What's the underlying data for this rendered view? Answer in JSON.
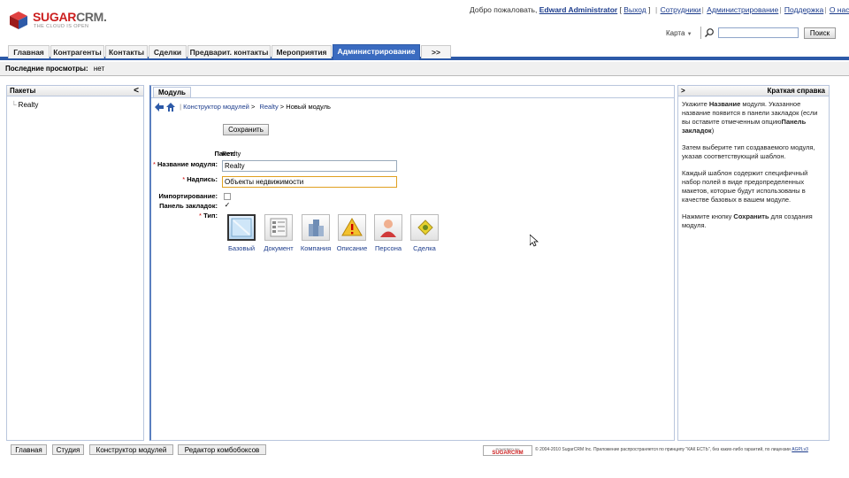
{
  "header": {
    "logo_brand_1": "SUGAR",
    "logo_brand_2": "CRM.",
    "logo_tagline": "THE CLOUD IS OPEN",
    "welcome_prefix": "Добро пожаловать,",
    "username": "Edward Administrator",
    "logout": "Выход",
    "links": [
      "Сотрудники",
      "Администрирование",
      "Поддержка",
      "О нас"
    ],
    "map_label": "Карта",
    "search_button": "Поиск",
    "search_placeholder": ""
  },
  "tabs": [
    {
      "label": "Главная"
    },
    {
      "label": "Контрагенты"
    },
    {
      "label": "Контакты"
    },
    {
      "label": "Сделки"
    },
    {
      "label": "Предварит. контакты"
    },
    {
      "label": "Мероприятия"
    },
    {
      "label": "Администрирование",
      "active": true
    },
    {
      "label": ">>"
    }
  ],
  "recent": {
    "label": "Последние просмотры:",
    "value": "нет"
  },
  "packages_panel": {
    "title": "Пакеты",
    "collapse_icon": "<",
    "items": [
      "Realty"
    ]
  },
  "main": {
    "tab_title": "Модуль",
    "breadcrumb": {
      "link1": "Конструктор модулей",
      "sep": ">",
      "link2": "Realty",
      "current": "Новый модуль"
    },
    "save_button": "Сохранить",
    "form": {
      "package_label": "Пакет:",
      "package_value": "Realty",
      "module_name_label": "Название модуля:",
      "module_name_value": "Realty",
      "caption_label": "Надпись:",
      "caption_value": "Объекты недвижимости",
      "importable_label": "Импортирование:",
      "importable_checked": false,
      "tab_panel_label": "Панель закладок:",
      "tab_panel_checked": true,
      "type_label": "Тип:",
      "required_mark": "*",
      "checkmark": "✓"
    },
    "types": [
      {
        "label": "Базовый",
        "icon": "basic-icon",
        "selected": true
      },
      {
        "label": "Документ",
        "icon": "document-icon"
      },
      {
        "label": "Компания",
        "icon": "company-icon"
      },
      {
        "label": "Описание",
        "icon": "issue-icon"
      },
      {
        "label": "Персона",
        "icon": "person-icon"
      },
      {
        "label": "Сделка",
        "icon": "sale-icon"
      }
    ]
  },
  "help": {
    "title": "Краткая справка",
    "expand_icon": ">",
    "p1_a": "Укажите ",
    "p1_b": "Название",
    "p1_c": " модуля. Указанное название появится в панели закладок (если вы оставите отмеченным опцию",
    "p1_d": "Панель закладок",
    "p1_e": ")",
    "p2": "Затем выберите тип создаваемого модуля, указав соответствующий шаблон.",
    "p3": "Каждый шаблон содержит специфичный набор полей в виде предопределенных макетов, которые будут использованы в качестве базовых в вашем модуле.",
    "p4_a": "Нажмите кнопку ",
    "p4_b": "Сохранить",
    "p4_c": " для создания модуля."
  },
  "footer": {
    "tabs": [
      "Главная",
      "Студия",
      "Конструктор модулей",
      "Редактор комбобоксов"
    ],
    "powered_1": "POWERED BY",
    "powered_2": "SUGARCRM",
    "copyright": "© 2004-2010 SugarCRM Inc. Приложение распространяется по принципу \"КАК ЕСТЬ\", без каких-либо гарантий, по лицензии",
    "license": "AGPLv3"
  }
}
